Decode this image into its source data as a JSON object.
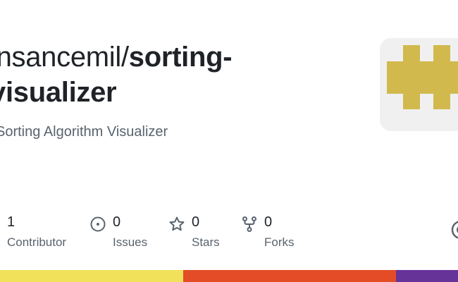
{
  "repo": {
    "owner_prefix": "insancemil/",
    "name": "sorting-visualizer",
    "description": "Sorting Algorithm Visualizer"
  },
  "stats": {
    "contributors": {
      "count": "1",
      "label": "Contributor"
    },
    "issues": {
      "count": "0",
      "label": "Issues",
      "icon": "issue-opened-icon"
    },
    "stars": {
      "count": "0",
      "label": "Stars",
      "icon": "star-icon"
    },
    "forks": {
      "count": "0",
      "label": "Forks",
      "icon": "repo-forked-icon"
    }
  },
  "avatar": {
    "icon": "identicon",
    "color": "#d1b94e",
    "background": "#f0f0f0"
  },
  "language_bar": [
    {
      "color": "#f1e05a",
      "fraction": 0.4
    },
    {
      "color": "#e34c26",
      "fraction": 0.465
    },
    {
      "color": "#663399",
      "fraction": 0.135
    }
  ],
  "colors": {
    "text_primary": "#1f2328",
    "text_secondary": "#59636e",
    "icon": "#59636e"
  }
}
